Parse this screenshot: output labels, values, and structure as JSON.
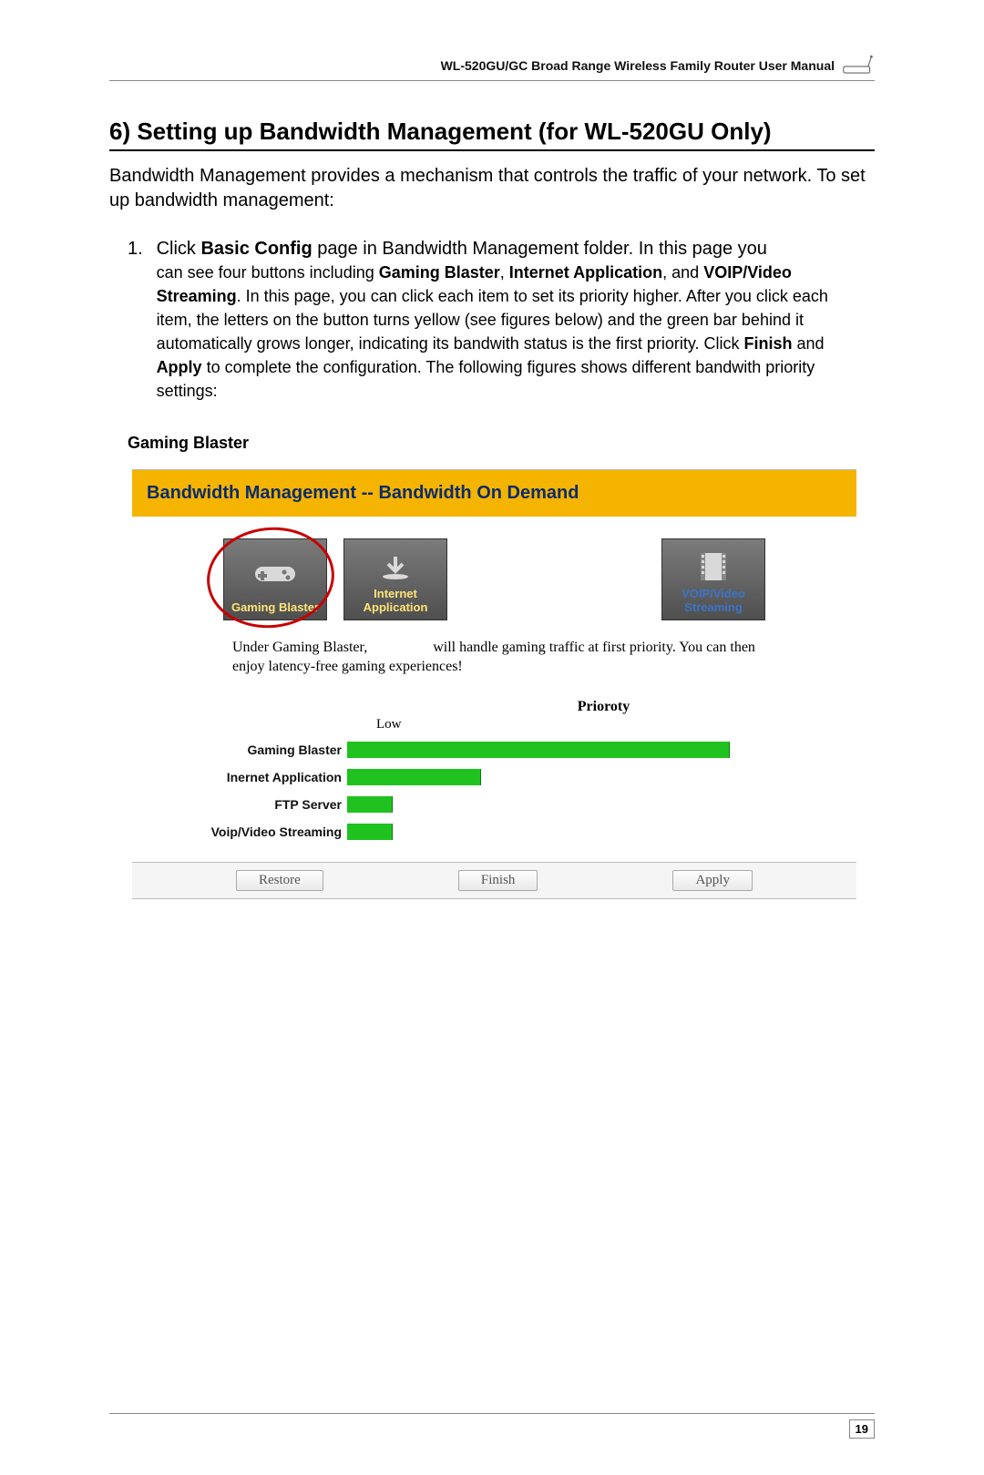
{
  "header": {
    "manual_title": "WL-520GU/GC Broad Range Wireless Family Router User Manual"
  },
  "section": {
    "title": "6) Setting up Bandwidth Management (for WL-520GU Only)",
    "intro": "Bandwidth Management provides a mechanism that controls the traffic of your network. To set up bandwidth management:",
    "step_num": "1.",
    "step_line1_a": "Click ",
    "step_line1_b": "Basic Config",
    "step_line1_c": " page in Bandwidth Management folder. In this page you",
    "step_sub_a": "can see four buttons including ",
    "step_sub_b": "Gaming Blaster",
    "step_sub_c": ", ",
    "step_sub_d": "Internet Application",
    "step_sub_e": ", and ",
    "step_sub_f": "VOIP/Video Streaming",
    "step_sub_g": ". In this page, you can click each item to set its priority higher. After you click each item, the letters on the button turns yellow (see figures below) and the green bar behind it automatically grows longer, indicating its bandwith status is the first priority. Click ",
    "step_sub_h": "Finish",
    "step_sub_i": " and ",
    "step_sub_j": "Apply",
    "step_sub_k": " to complete the configuration. The following figures shows different bandwith priority settings:",
    "sub_heading": "Gaming Blaster"
  },
  "figure": {
    "banner": "Bandwidth Management -- Bandwidth On Demand",
    "tiles": {
      "gaming": "Gaming Blaster",
      "internet": "Internet Application",
      "voip": "VOIP/Video Streaming"
    },
    "desc_a": "Under Gaming Blaster,",
    "desc_b": "will handle gaming traffic at first priority. You can then enjoy latency-free gaming experiences!",
    "priority_title": "Prioroty",
    "low": "Low",
    "chart_data": {
      "type": "bar",
      "title": "Prioroty",
      "xlabel": "Low",
      "ylabel": "",
      "categories": [
        "Gaming Blaster",
        "Inernet Application",
        "FTP Server",
        "Voip/Video Streaming"
      ],
      "values": [
        100,
        35,
        12,
        12
      ],
      "ylim": [
        0,
        100
      ]
    },
    "buttons": {
      "restore": "Restore",
      "finish": "Finish",
      "apply": "Apply"
    }
  },
  "footer": {
    "page_num": "19"
  }
}
